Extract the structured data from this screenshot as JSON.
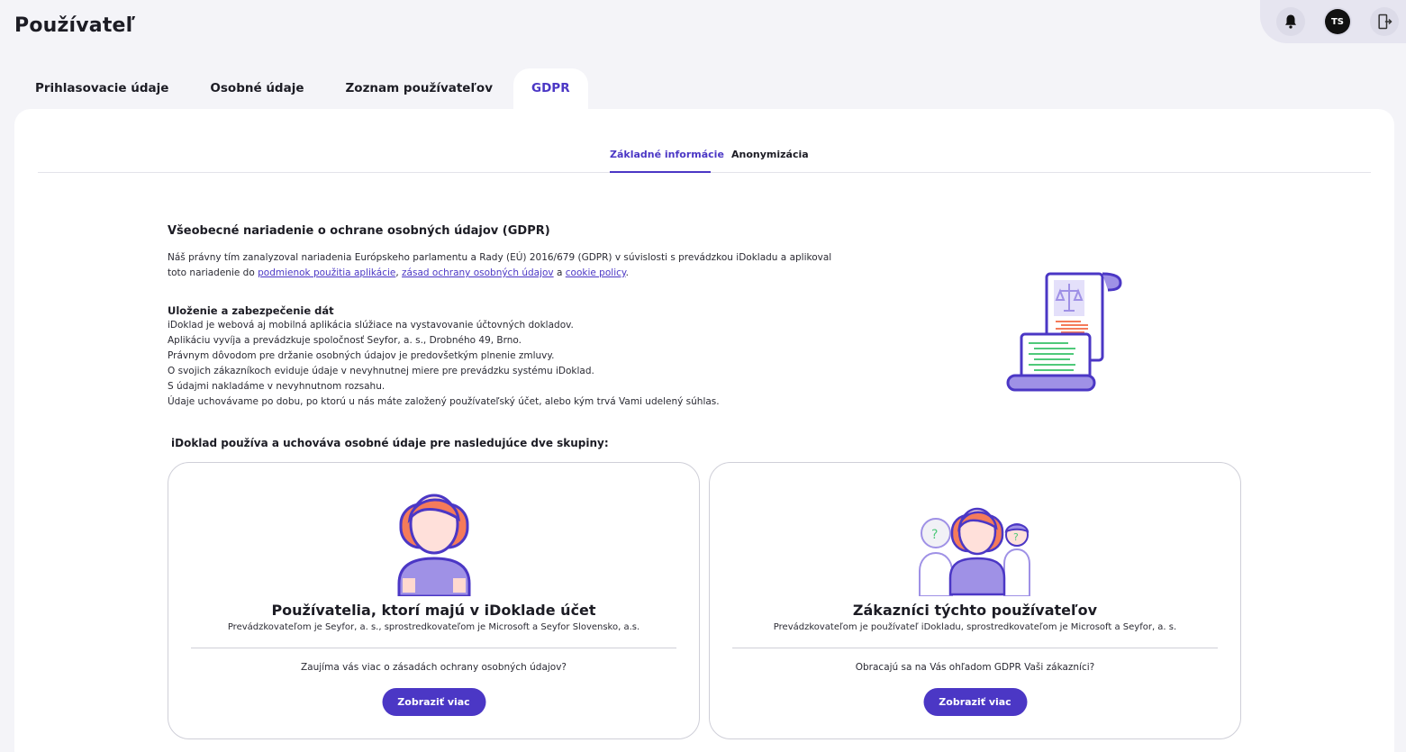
{
  "page": {
    "title": "Používateľ"
  },
  "topbar": {
    "avatar_initials": "TS",
    "icons": [
      "bell-icon",
      "logout-icon"
    ]
  },
  "main_tabs": [
    {
      "label": "Prihlasovacie údaje",
      "active": false
    },
    {
      "label": "Osobné údaje",
      "active": false
    },
    {
      "label": "Zoznam používateľov",
      "active": false
    },
    {
      "label": "GDPR",
      "active": true
    }
  ],
  "sub_tabs": [
    {
      "label": "Základné informácie",
      "active": true
    },
    {
      "label": "Anonymizácia",
      "active": false
    }
  ],
  "intro": {
    "title": "Všeobecné nariadenie o ochrane osobných údajov (GDPR)",
    "text_before": "Náš právny tím zanalyzoval nariadenia Európskeho parlamentu a Rady (EÚ) 2016/679 (GDPR) v súvislosti s prevádzkou iDokladu a aplikoval toto nariadenie do ",
    "link1": "podmienok použitia aplikácie",
    "sep1": ", ",
    "link2": "zásad ochrany osobných údajov",
    "sep2": " a ",
    "link3": "cookie policy",
    "text_after": "."
  },
  "storage": {
    "title": "Uloženie a zabezpečenie dát",
    "lines": [
      "iDoklad je webová aj mobilná aplikácia slúžiace na vystavovanie účtovných dokladov.",
      "Aplikáciu vyvíja a prevádzkuje spoločnosť Seyfor, a. s., Drobného 49, Brno.",
      "Právnym dôvodom pre držanie osobných údajov je predovšetkým plnenie zmluvy.",
      "O svojich zákazníkoch eviduje údaje v nevyhnutnej miere pre prevádzku systému iDoklad.",
      "S údajmi nakladáme v nevyhnutnom rozsahu.",
      "Údaje uchovávame po dobu, po ktorú u nás máte založený používateľský účet, alebo kým trvá Vami udelený súhlas."
    ]
  },
  "groups_title": "iDoklad používa a uchováva osobné údaje pre nasledujúce dve skupiny:",
  "cards": [
    {
      "title": "Používatelia, ktorí majú v iDoklade účet",
      "desc": "Prevádzkovateľom je Seyfor, a. s., sprostredkovateľom je Microsoft a Seyfor Slovensko, a.s.",
      "question": "Zaujíma vás viac o zásadách ochrany osobných údajov?",
      "button": "Zobraziť viac"
    },
    {
      "title": "Zákazníci týchto používateľov",
      "desc": "Prevádzkovateľom je používateľ iDokladu, sprostredkovateľom je Microsoft a Seyfor, a. s.",
      "question": "Obracajú sa na Vás ohľadom GDPR Vaši zákazníci?",
      "button": "Zobraziť viac"
    }
  ],
  "colors": {
    "accent": "#4b37c5",
    "hair": "#f47b5a",
    "shirt": "#9f91e6"
  }
}
